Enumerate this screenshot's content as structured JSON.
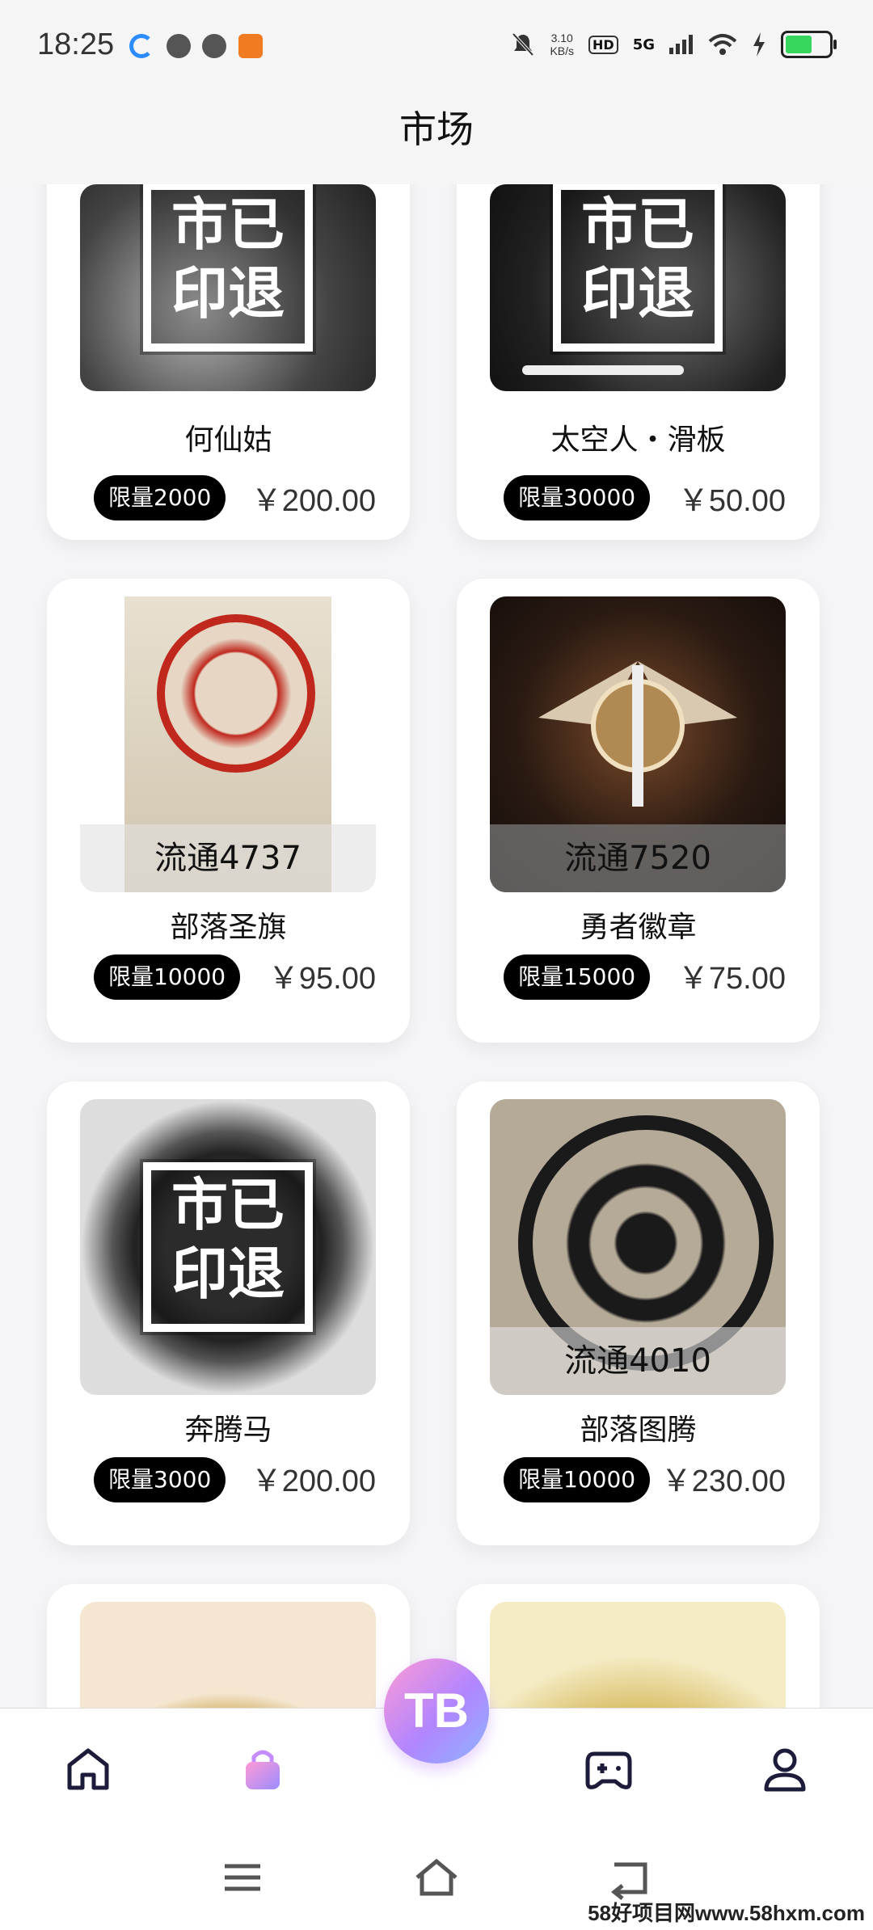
{
  "status_bar": {
    "time": "18:25",
    "net_speed": "3.10",
    "net_unit": "KB/s",
    "hd": "HD",
    "network": "5G"
  },
  "header": {
    "title": "市场"
  },
  "items": [
    {
      "name": "何仙姑",
      "limit": "限量2000",
      "price": "￥200.00",
      "stamp": "市已印退"
    },
    {
      "name": "太空人・滑板",
      "limit": "限量30000",
      "price": "￥50.00",
      "stamp": "市已印退"
    },
    {
      "name": "部落圣旗",
      "limit": "限量10000",
      "price": "￥95.00",
      "circulation": "流通4737"
    },
    {
      "name": "勇者徽章",
      "limit": "限量15000",
      "price": "￥75.00",
      "circulation": "流通7520"
    },
    {
      "name": "奔腾马",
      "limit": "限量3000",
      "price": "￥200.00",
      "stamp": "市已印退"
    },
    {
      "name": "部落图腾",
      "limit": "限量10000",
      "price": "￥230.00",
      "circulation": "流通4010"
    }
  ],
  "bottom_nav": {
    "center_badge": "TB",
    "tabs": [
      "home-icon",
      "shopping-bag-icon",
      "gamepad-icon",
      "profile-icon"
    ]
  },
  "watermark": "58好项目网www.58hxm.com",
  "colors": {
    "accent": "#c48cff",
    "badge": "#000000"
  }
}
